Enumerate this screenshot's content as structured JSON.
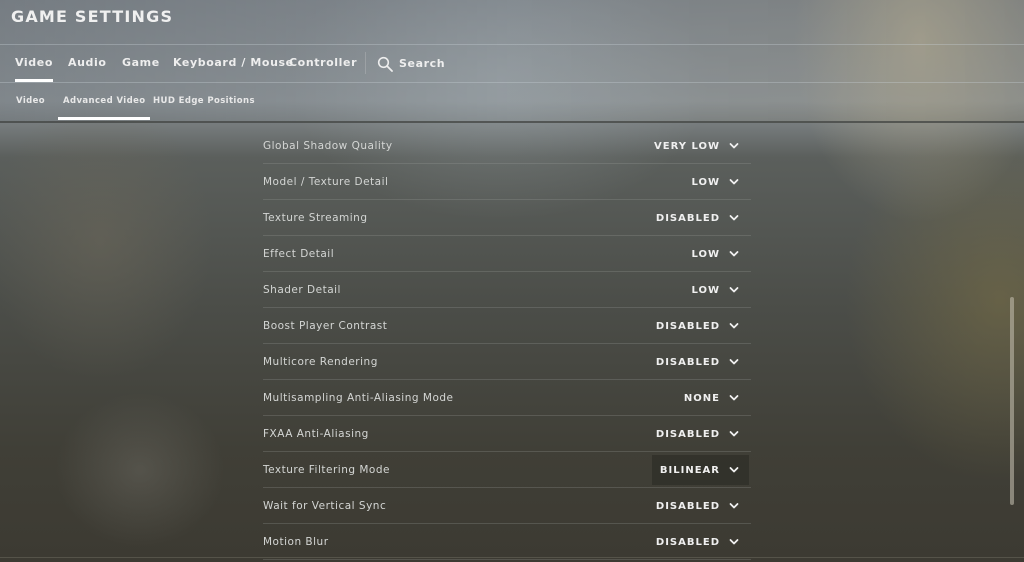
{
  "header": {
    "title": "GAME SETTINGS"
  },
  "tabs": [
    {
      "label": "Video",
      "active": true
    },
    {
      "label": "Audio",
      "active": false
    },
    {
      "label": "Game",
      "active": false
    },
    {
      "label": "Keyboard / Mouse",
      "active": false
    },
    {
      "label": "Controller",
      "active": false
    }
  ],
  "search": {
    "label": "Search",
    "icon": "search-icon"
  },
  "subtabs": [
    {
      "label": "Video",
      "active": false
    },
    {
      "label": "Advanced Video",
      "active": true
    },
    {
      "label": "HUD Edge Positions",
      "active": false
    }
  ],
  "settings": [
    {
      "label": "Global Shadow Quality",
      "value": "VERY LOW"
    },
    {
      "label": "Model / Texture Detail",
      "value": "LOW"
    },
    {
      "label": "Texture Streaming",
      "value": "DISABLED"
    },
    {
      "label": "Effect Detail",
      "value": "LOW"
    },
    {
      "label": "Shader Detail",
      "value": "LOW"
    },
    {
      "label": "Boost Player Contrast",
      "value": "DISABLED"
    },
    {
      "label": "Multicore Rendering",
      "value": "DISABLED"
    },
    {
      "label": "Multisampling Anti-Aliasing Mode",
      "value": "NONE"
    },
    {
      "label": "FXAA Anti-Aliasing",
      "value": "DISABLED"
    },
    {
      "label": "Texture Filtering Mode",
      "value": "BILINEAR",
      "hovered": true
    },
    {
      "label": "Wait for Vertical Sync",
      "value": "DISABLED"
    },
    {
      "label": "Motion Blur",
      "value": "DISABLED"
    }
  ],
  "icons": {
    "dropdown": "chevron-down-icon"
  }
}
